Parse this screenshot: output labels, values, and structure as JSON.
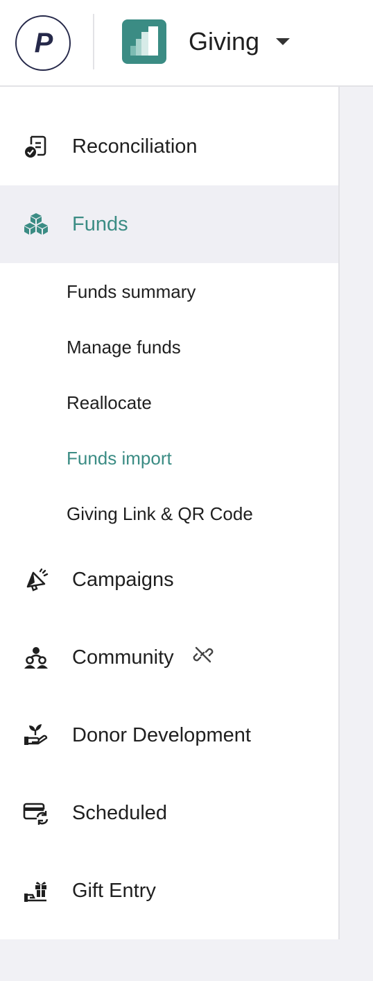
{
  "header": {
    "logo_text": "P",
    "app_title": "Giving",
    "accent_color": "#3b8c84"
  },
  "sidebar": {
    "items": [
      {
        "label": "Reconciliation",
        "icon": "reconciliation-icon"
      },
      {
        "label": "Funds",
        "icon": "funds-cubes-icon",
        "active": true
      },
      {
        "label": "Campaigns",
        "icon": "campaigns-megaphone-icon"
      },
      {
        "label": "Community",
        "icon": "community-people-icon",
        "badge_icon": "unlinked-icon"
      },
      {
        "label": "Donor Development",
        "icon": "donor-hand-plant-icon"
      },
      {
        "label": "Scheduled",
        "icon": "scheduled-card-refresh-icon"
      },
      {
        "label": "Gift Entry",
        "icon": "gift-entry-icon"
      }
    ],
    "funds_subitems": [
      {
        "label": "Funds summary"
      },
      {
        "label": "Manage funds"
      },
      {
        "label": "Reallocate"
      },
      {
        "label": "Funds import",
        "active": true
      },
      {
        "label": "Giving Link & QR Code"
      }
    ]
  }
}
